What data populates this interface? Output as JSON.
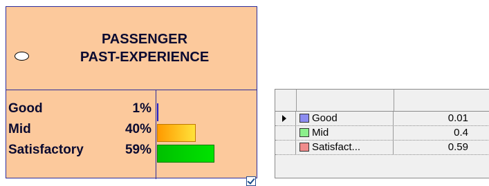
{
  "node": {
    "title_line1": "PASSENGER",
    "title_line2": "PAST-EXPERIENCE",
    "states": [
      {
        "label": "Good",
        "percent": "1%",
        "probability": 0.01
      },
      {
        "label": "Mid",
        "percent": "40%",
        "probability": 0.4
      },
      {
        "label": "Satisfactory",
        "percent": "59%",
        "probability": 0.59
      }
    ],
    "icon": "ellipse-icon",
    "checkbox_checked": true
  },
  "grid": {
    "rows": [
      {
        "name": "Good",
        "value": "0.01",
        "color": "#8c8cf0"
      },
      {
        "name": "Mid",
        "value": "0.4",
        "color": "#8cf08c"
      },
      {
        "name": "Satisfact...",
        "value": "0.59",
        "color": "#f08c8c"
      }
    ],
    "current_row_indicator": "row-arrow-icon"
  }
}
